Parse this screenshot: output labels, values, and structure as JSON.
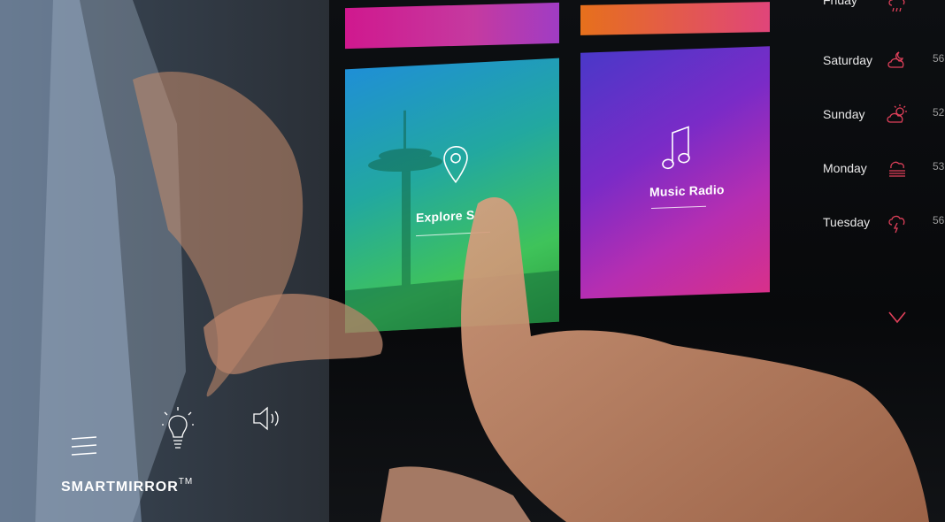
{
  "tiles": {
    "explore": {
      "label": "Explore S",
      "icon": "location-pin-icon"
    },
    "music": {
      "label": "Music Radio",
      "icon": "music-note-icon"
    }
  },
  "weather": {
    "days": [
      {
        "day": "Friday",
        "icon": "cloud-rain-icon",
        "temp": ""
      },
      {
        "day": "Saturday",
        "icon": "cloud-moon-icon",
        "temp": "56"
      },
      {
        "day": "Sunday",
        "icon": "partly-sunny-icon",
        "temp": "52"
      },
      {
        "day": "Monday",
        "icon": "fog-icon",
        "temp": "53"
      },
      {
        "day": "Tuesday",
        "icon": "thunderstorm-icon",
        "temp": "56"
      }
    ],
    "more_icon": "chevron-down-icon"
  },
  "controls": {
    "menu_icon": "menu-icon",
    "light_icon": "lightbulb-icon",
    "volume_icon": "volume-icon"
  },
  "brand": {
    "name": "SMARTMIRROR",
    "tm": "TM"
  },
  "colors": {
    "accent": "#e0405a",
    "explore_tile": "#2fae6a",
    "music_tile": "#8a2fc4"
  }
}
